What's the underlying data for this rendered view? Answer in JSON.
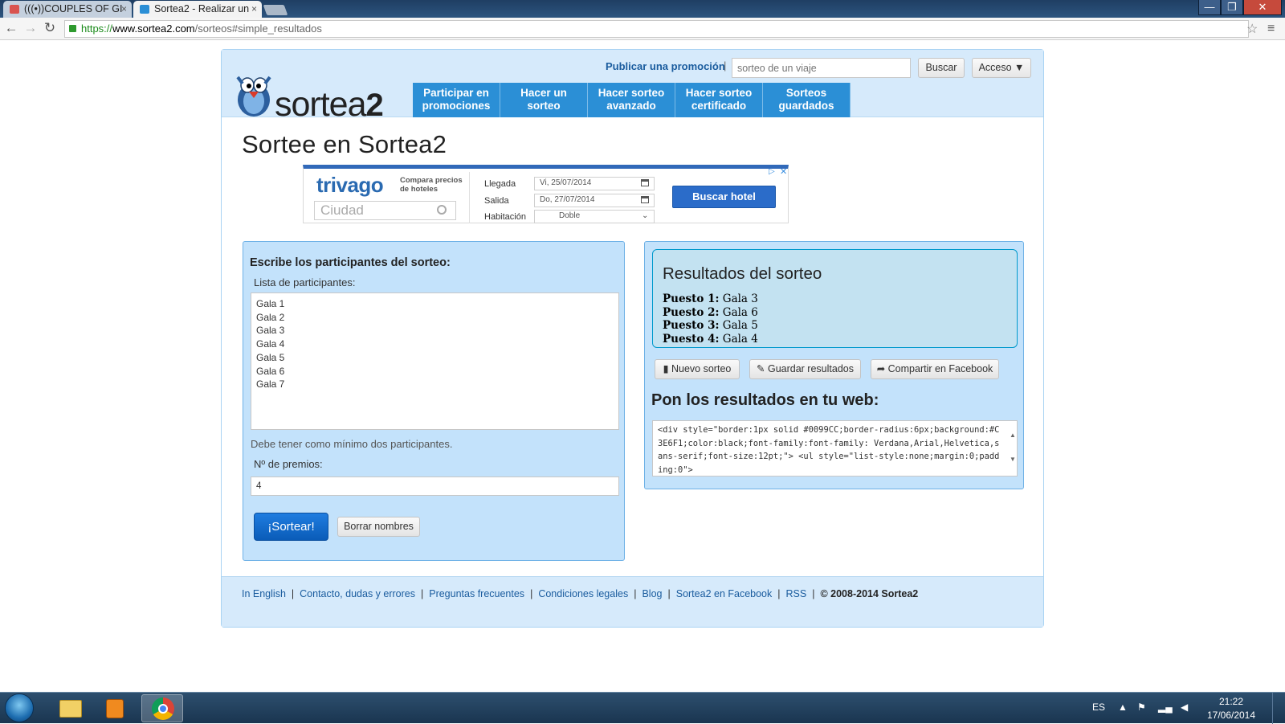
{
  "browser": {
    "tabs": [
      {
        "label": "(((•))COUPLES OF GI",
        "close": "×"
      },
      {
        "label": "Sortea2 - Realizar un",
        "close": "×"
      }
    ],
    "url": {
      "scheme": "https://",
      "host": "www.sortea2.com",
      "path": "/sorteos#simple_resultados"
    },
    "window_buttons": {
      "minimize": "—",
      "maximize": "❐",
      "close": "✕"
    }
  },
  "header": {
    "logo_text": "sortea",
    "logo_sup": "2",
    "promo_link": "Publicar una promoción",
    "promo_sep": "|",
    "search_placeholder": "sorteo de un viaje",
    "search_button": "Buscar",
    "access_button": "Acceso ▼",
    "nav": [
      {
        "line1": "Participar en",
        "line2": "promociones"
      },
      {
        "line1": "Hacer un",
        "line2": "sorteo"
      },
      {
        "line1": "Hacer sorteo",
        "line2": "avanzado"
      },
      {
        "line1": "Hacer sorteo",
        "line2": "certificado"
      },
      {
        "line1": "Sorteos",
        "line2": "guardados"
      }
    ]
  },
  "page_title": "Sortee en Sortea2",
  "ad": {
    "brand_a": "trivago",
    "tagline": "Compara precios de hoteles",
    "city_placeholder": "Ciudad",
    "arrival_label": "Llegada",
    "arrival_value": "Vi, 25/07/2014",
    "departure_label": "Salida",
    "departure_value": "Do, 27/07/2014",
    "room_label": "Habitación",
    "room_value": "Doble",
    "button": "Buscar hotel",
    "choices": "▷",
    "close": "✕"
  },
  "form": {
    "title": "Escribe los participantes del sorteo:",
    "list_label": "Lista de participantes:",
    "participants": "Gala 1\nGala 2\nGala 3\nGala 4\nGala 5\nGala 6\nGala 7",
    "min_note": "Debe tener como mínimo dos participantes.",
    "prizes_label": "Nº de premios:",
    "prizes_value": "4",
    "draw_button": "¡Sortear!",
    "clear_button": "Borrar nombres"
  },
  "results": {
    "title": "Resultados del sorteo",
    "items": [
      {
        "label": "Puesto 1:",
        "value": "Gala 3"
      },
      {
        "label": "Puesto 2:",
        "value": "Gala 6"
      },
      {
        "label": "Puesto 3:",
        "value": "Gala 5"
      },
      {
        "label": "Puesto 4:",
        "value": "Gala 4"
      }
    ],
    "new_button": "Nuevo sorteo",
    "save_button": "Guardar resultados",
    "share_button": "Compartir en Facebook",
    "embed_title": "Pon los resultados en tu web:",
    "embed_code": "<div style=\"border:1px solid #0099CC;border-radius:6px;background:#C3E6F1;color:black;font-family:font-family: Verdana,Arial,Helvetica,sans-serif;font-size:12pt;\">\n<ul style=\"list-style:none;margin:0;padding:0\">"
  },
  "footer": {
    "links": [
      "In English",
      "Contacto, dudas y errores",
      "Preguntas frecuentes",
      "Condiciones legales",
      "Blog",
      "Sortea2 en Facebook",
      "RSS"
    ],
    "copyright": "© 2008-2014 Sortea2"
  },
  "taskbar": {
    "lang": "ES",
    "time": "21:22",
    "date": "17/06/2014"
  }
}
